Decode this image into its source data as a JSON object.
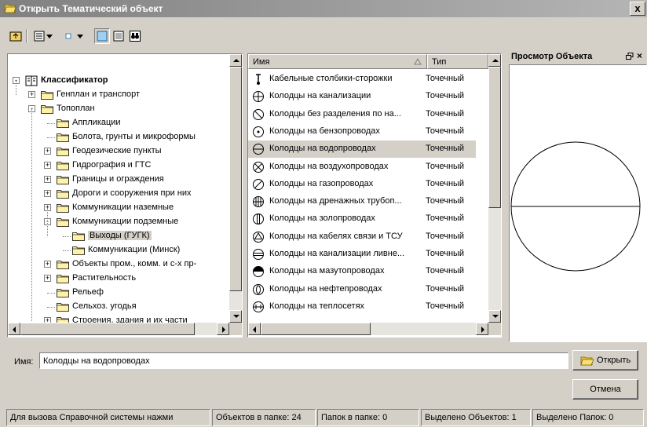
{
  "window": {
    "title": "Открыть Тематический объект",
    "close_label": "x"
  },
  "toolbar": {
    "icons": [
      "folder-up-icon",
      "list-view-icon",
      "dropdown-icon",
      "small-icons-icon",
      "dropdown-icon",
      "large-icons-view-icon",
      "details-view-icon",
      "binoculars-icon"
    ]
  },
  "tree": {
    "root": "Классификатор",
    "items": [
      {
        "label": "Генплан и транспорт",
        "level": 1,
        "expander": "+"
      },
      {
        "label": "Топоплан",
        "level": 1,
        "expander": "-"
      },
      {
        "label": "Аппликации",
        "level": 2,
        "expander": ""
      },
      {
        "label": "Болота, грунты и микроформы",
        "level": 2,
        "expander": ""
      },
      {
        "label": "Геодезические пункты",
        "level": 2,
        "expander": "+"
      },
      {
        "label": "Гидрография и ГТС",
        "level": 2,
        "expander": "+"
      },
      {
        "label": "Границы и ограждения",
        "level": 2,
        "expander": "+"
      },
      {
        "label": "Дороги и сооружения при них",
        "level": 2,
        "expander": "+"
      },
      {
        "label": "Коммуникации наземные",
        "level": 2,
        "expander": "+"
      },
      {
        "label": "Коммуникации подземные",
        "level": 2,
        "expander": "-"
      },
      {
        "label": "Выходы (ГУГК)",
        "level": 3,
        "expander": "",
        "selected": true
      },
      {
        "label": "Коммуникации (Минск)",
        "level": 3,
        "expander": ""
      },
      {
        "label": "Объекты пром., комм. и с-х пр-",
        "level": 2,
        "expander": "+"
      },
      {
        "label": "Растительность",
        "level": 2,
        "expander": "+"
      },
      {
        "label": "Рельеф",
        "level": 2,
        "expander": ""
      },
      {
        "label": "Сельхоз. угодья",
        "level": 2,
        "expander": ""
      },
      {
        "label": "Строения, здания и их части",
        "level": 2,
        "expander": "+"
      }
    ]
  },
  "list": {
    "col_name": "Имя",
    "col_type": "Тип",
    "rows": [
      {
        "name": "Кабельные столбики-сторожки",
        "type": "Точечный",
        "icon": "cable-post-icon"
      },
      {
        "name": "Колодцы  на канализации",
        "type": "Точечный",
        "icon": "circle-cross-icon"
      },
      {
        "name": "Колодцы без разделения по на...",
        "type": "Точечный",
        "icon": "circle-slash-icon"
      },
      {
        "name": "Колодцы на бензопроводах",
        "type": "Точечный",
        "icon": "circle-dot-icon"
      },
      {
        "name": "Колодцы на водопроводах",
        "type": "Точечный",
        "icon": "circle-hline-icon",
        "selected": true
      },
      {
        "name": "Колодцы на воздухопроводах",
        "type": "Точечный",
        "icon": "circle-x-icon"
      },
      {
        "name": "Колодцы на газопроводах",
        "type": "Точечный",
        "icon": "circle-diag-icon"
      },
      {
        "name": "Колодцы на дренажных трубоп...",
        "type": "Точечный",
        "icon": "circle-grid-icon"
      },
      {
        "name": "Колодцы на золопроводах",
        "type": "Точечный",
        "icon": "circle-vbar-icon"
      },
      {
        "name": "Колодцы на кабелях связи и ТСУ",
        "type": "Точечный",
        "icon": "circle-triangle-icon"
      },
      {
        "name": "Колодцы на канализации ливне...",
        "type": "Точечный",
        "icon": "circle-double-hline-icon"
      },
      {
        "name": "Колодцы на мазутопроводах",
        "type": "Точечный",
        "icon": "circle-half-filled-icon"
      },
      {
        "name": "Колодцы на нефтепроводах",
        "type": "Точечный",
        "icon": "circle-oval-icon"
      },
      {
        "name": "Колодцы на теплосетях",
        "type": "Точечный",
        "icon": "circle-hline-ticks-icon"
      }
    ]
  },
  "preview": {
    "title": "Просмотр Объекта",
    "pin_icon": "restore-icon",
    "close_label": "×"
  },
  "name_field": {
    "label": "Имя:",
    "value": "Колодцы на водопроводах"
  },
  "buttons": {
    "open": "Открыть",
    "cancel": "Отмена"
  },
  "status": [
    "Для вызова Справочной системы нажми",
    "Объектов в папке: 24",
    "Папок в папке: 0",
    "Выделено Объектов: 1",
    "Выделено Папок: 0"
  ]
}
